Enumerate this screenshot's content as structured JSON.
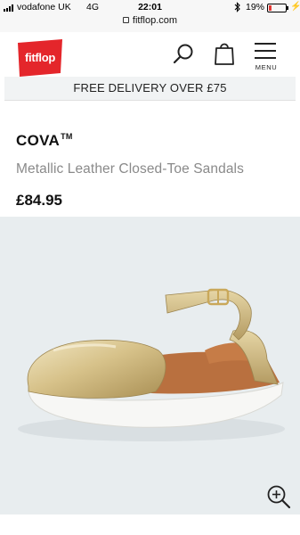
{
  "status_bar": {
    "carrier": "vodafone UK",
    "network": "4G",
    "time": "22:01",
    "battery_percent": "19%",
    "battery_level": 0.19,
    "url": "fitflop.com"
  },
  "header": {
    "logo_text": "fitflop",
    "menu_label": "MENU",
    "icons": [
      "search-icon",
      "bag-icon",
      "menu-icon"
    ],
    "brand_color": "#e4262b"
  },
  "promo": {
    "text": "FREE DELIVERY OVER £75"
  },
  "product": {
    "name": "COVA",
    "trademark": "TM",
    "description": "Metallic Leather Closed-Toe Sandals",
    "price": "£84.95"
  },
  "image_area": {
    "background": "#e8edef",
    "zoom_icon": "zoom-in-icon"
  }
}
